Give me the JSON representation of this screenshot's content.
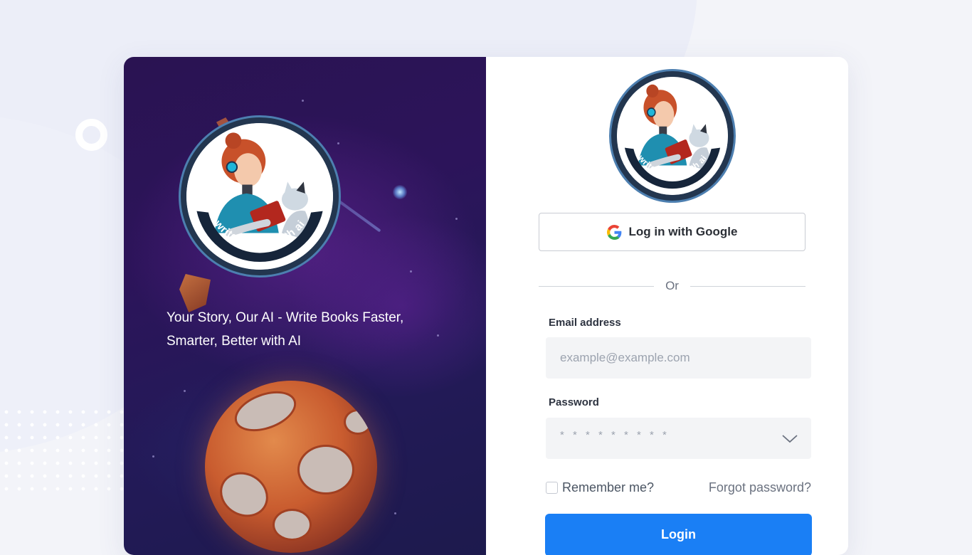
{
  "brand": {
    "logo_text": "write books with ai",
    "tagline": "Your Story, Our AI - Write Books Faster, Smarter, Better with AI"
  },
  "login": {
    "google_label": "Log in with Google",
    "divider_text": "Or",
    "email_label": "Email address",
    "email_placeholder": "example@example.com",
    "password_label": "Password",
    "password_mask": "* * * * * * * * *",
    "remember_label": "Remember me?",
    "forgot_label": "Forgot password?",
    "submit_label": "Login"
  },
  "colors": {
    "accent": "#1a7ff5",
    "left_panel": "#2a1352",
    "background": "#f3f4f9"
  },
  "icons": {
    "google": "google-g-icon",
    "password_toggle": "chevron-down-icon"
  }
}
